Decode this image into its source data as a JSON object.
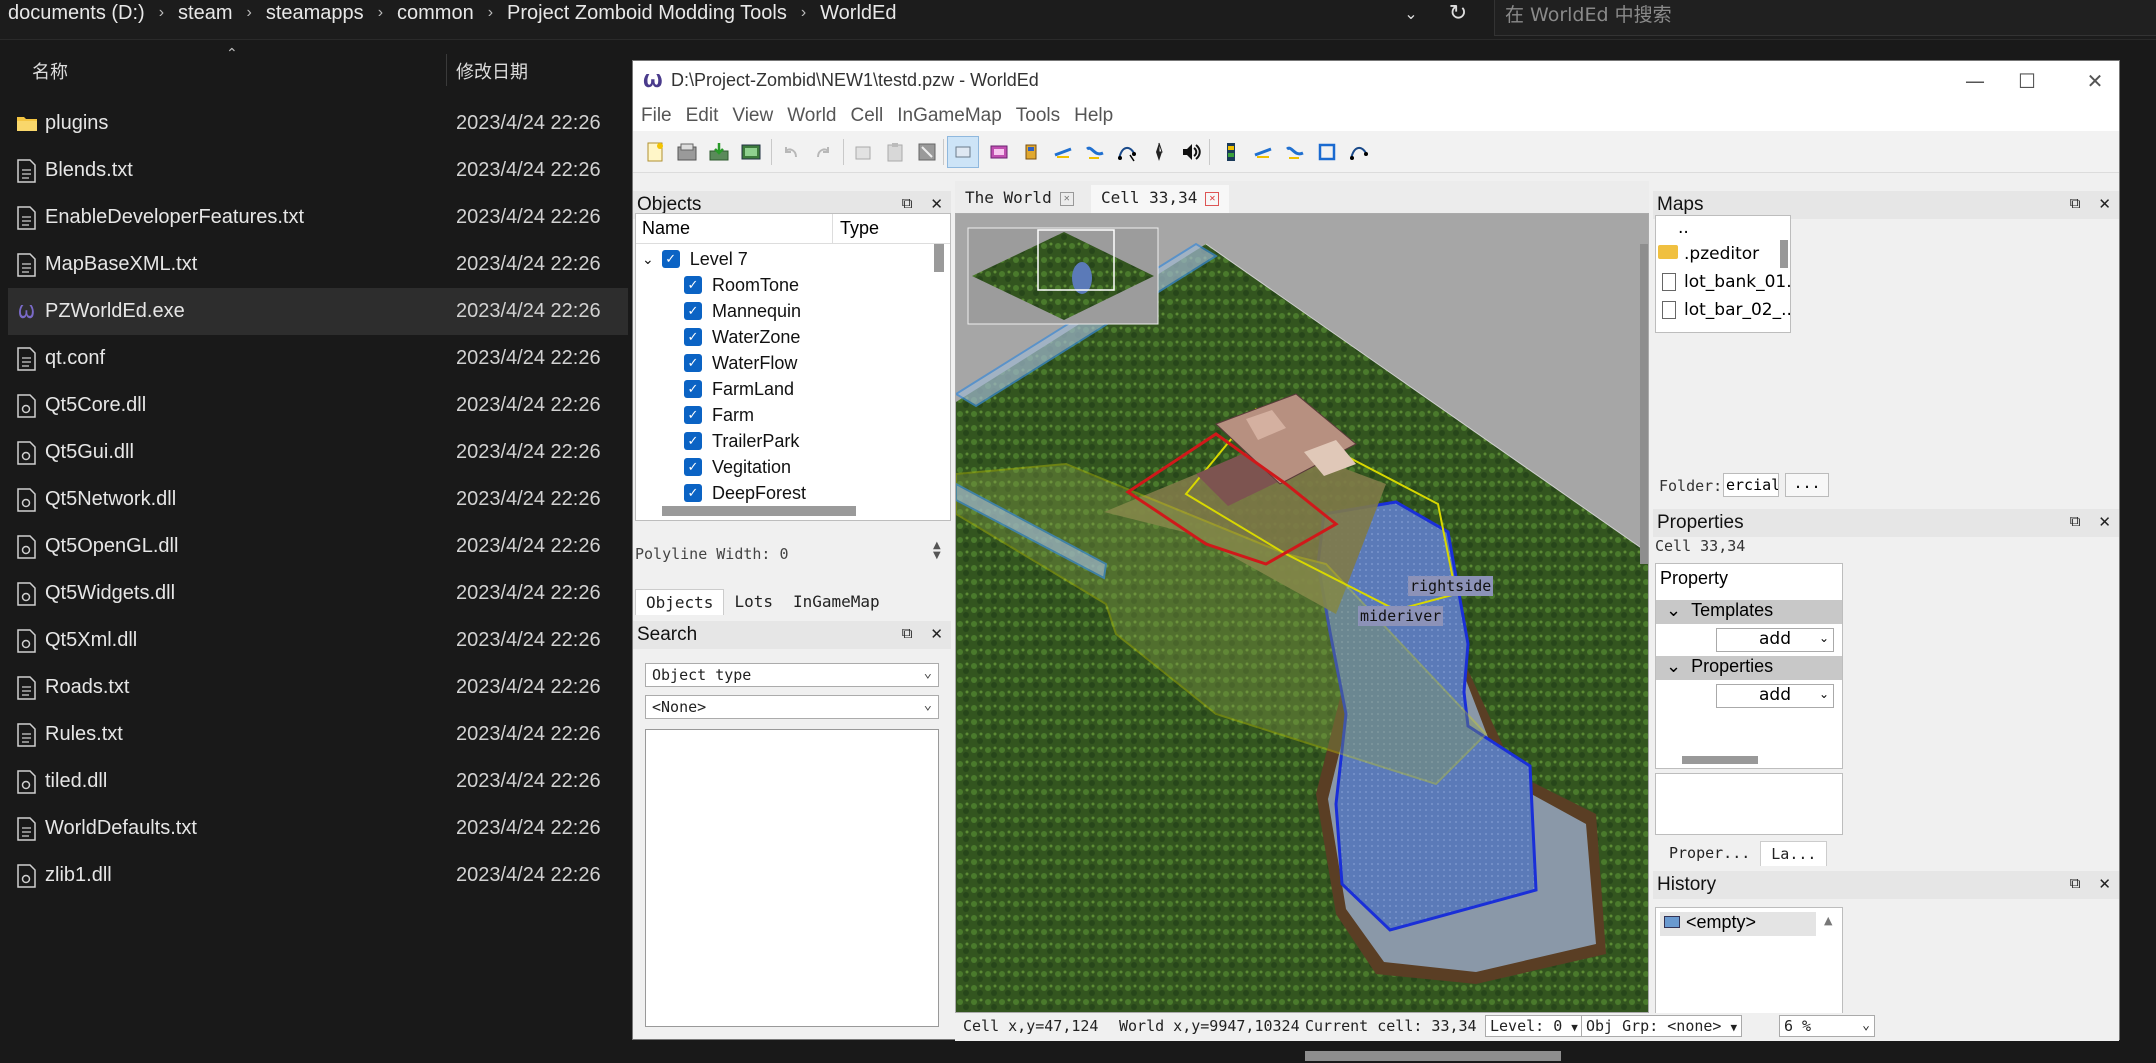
{
  "explorer": {
    "breadcrumb": [
      "documents (D:)",
      "steam",
      "steamapps",
      "common",
      "Project Zomboid Modding Tools",
      "WorldEd"
    ],
    "search_placeholder": "在 WorldEd 中搜索",
    "col_name": "名称",
    "col_date": "修改日期",
    "files": [
      {
        "name": "plugins",
        "date": "2023/4/24 22:26",
        "icon": "folder-icon"
      },
      {
        "name": "Blends.txt",
        "date": "2023/4/24 22:26",
        "icon": "text-file-icon"
      },
      {
        "name": "EnableDeveloperFeatures.txt",
        "date": "2023/4/24 22:26",
        "icon": "text-file-icon"
      },
      {
        "name": "MapBaseXML.txt",
        "date": "2023/4/24 22:26",
        "icon": "text-file-icon"
      },
      {
        "name": "PZWorldEd.exe",
        "date": "2023/4/24 22:26",
        "icon": "exe-icon"
      },
      {
        "name": "qt.conf",
        "date": "2023/4/24 22:26",
        "icon": "text-file-icon"
      },
      {
        "name": "Qt5Core.dll",
        "date": "2023/4/24 22:26",
        "icon": "dll-icon"
      },
      {
        "name": "Qt5Gui.dll",
        "date": "2023/4/24 22:26",
        "icon": "dll-icon"
      },
      {
        "name": "Qt5Network.dll",
        "date": "2023/4/24 22:26",
        "icon": "dll-icon"
      },
      {
        "name": "Qt5OpenGL.dll",
        "date": "2023/4/24 22:26",
        "icon": "dll-icon"
      },
      {
        "name": "Qt5Widgets.dll",
        "date": "2023/4/24 22:26",
        "icon": "dll-icon"
      },
      {
        "name": "Qt5Xml.dll",
        "date": "2023/4/24 22:26",
        "icon": "dll-icon"
      },
      {
        "name": "Roads.txt",
        "date": "2023/4/24 22:26",
        "icon": "text-file-icon"
      },
      {
        "name": "Rules.txt",
        "date": "2023/4/24 22:26",
        "icon": "text-file-icon"
      },
      {
        "name": "tiled.dll",
        "date": "2023/4/24 22:26",
        "icon": "dll-icon"
      },
      {
        "name": "WorldDefaults.txt",
        "date": "2023/4/24 22:26",
        "icon": "text-file-icon"
      },
      {
        "name": "zlib1.dll",
        "date": "2023/4/24 22:26",
        "icon": "dll-icon"
      }
    ]
  },
  "worlded": {
    "title": "D:\\Project-Zombid\\NEW1\\testd.pzw - WorldEd",
    "menu": [
      "File",
      "Edit",
      "View",
      "World",
      "Cell",
      "InGameMap",
      "Tools",
      "Help"
    ],
    "objects_panel": {
      "title": "Objects",
      "col_name": "Name",
      "col_type": "Type",
      "level": "Level 7",
      "items": [
        "RoomTone",
        "Mannequin",
        "WaterZone",
        "WaterFlow",
        "FarmLand",
        "Farm",
        "TrailerPark",
        "Vegitation",
        "DeepForest"
      ],
      "polyline_label": "Polyline Width:",
      "polyline_value": "0",
      "tabs": [
        "Objects",
        "Lots",
        "InGameMap"
      ]
    },
    "search_panel": {
      "title": "Search",
      "object_type": "Object type",
      "none_value": "<None>"
    },
    "doc_tabs": [
      "The World",
      "Cell 33,34"
    ],
    "map_labels": {
      "rightside": "rightside",
      "mideriver": "mideriver"
    },
    "maps_panel": {
      "title": "Maps",
      "items": [
        "..",
        ".pzeditor",
        "lot_bank_01....",
        "lot_bar_02_..."
      ],
      "folder_label": "Folder:",
      "folder_value": "ercial",
      "browse": "..."
    },
    "properties_panel": {
      "title": "Properties",
      "cell": "Cell 33,34",
      "col_property": "Property",
      "groups": [
        "Templates",
        "Properties"
      ],
      "add_label": "add",
      "tabs": [
        "Proper...",
        "La..."
      ]
    },
    "history_panel": {
      "title": "History",
      "items": [
        "<empty>"
      ]
    },
    "status": {
      "cell_xy": "Cell x,y=47,124",
      "world_xy": "World x,y=9947,10324",
      "current_cell": "Current cell: 33,34",
      "level": "Level: 0",
      "obj_grp": "Obj Grp: <none>",
      "zoom": "6 %"
    }
  }
}
